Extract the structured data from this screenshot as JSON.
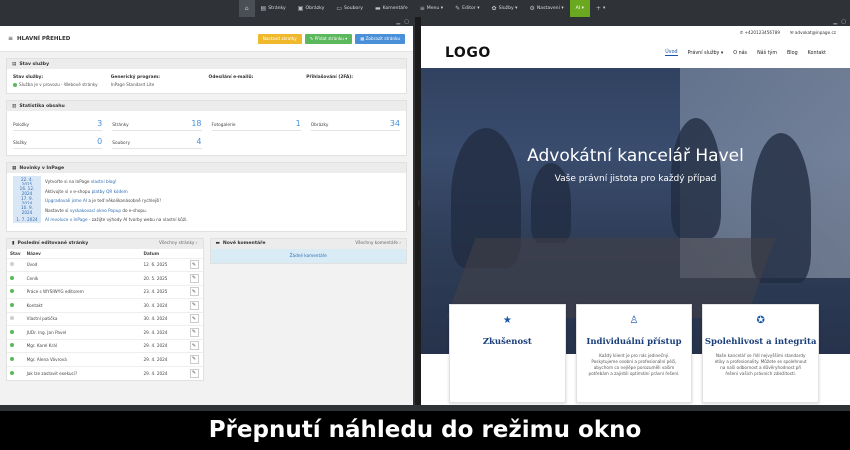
{
  "topbar": {
    "items": [
      {
        "icon": "home-icon",
        "glyph": "⌂",
        "label": ""
      },
      {
        "icon": "pages-icon",
        "glyph": "▤",
        "label": "Stránky"
      },
      {
        "icon": "image-icon",
        "glyph": "▣",
        "label": "Obrázky"
      },
      {
        "icon": "folder-icon",
        "glyph": "▭",
        "label": "Soubory"
      },
      {
        "icon": "comment-icon",
        "glyph": "▬",
        "label": "Komentáře"
      },
      {
        "icon": "menu-icon",
        "glyph": "≡",
        "label": "Menu ▾"
      },
      {
        "icon": "pencil-icon",
        "glyph": "✎",
        "label": "Editor ▾"
      },
      {
        "icon": "services-icon",
        "glyph": "✿",
        "label": "Služby ▾"
      },
      {
        "icon": "gear-icon",
        "glyph": "⚙",
        "label": "Nastavení ▾"
      },
      {
        "icon": "",
        "glyph": "",
        "label": "AI ▾"
      },
      {
        "icon": "plus-icon",
        "glyph": "+",
        "label": "▾"
      }
    ]
  },
  "admin": {
    "title": "HLAVNÍ PŘEHLED",
    "buttons": {
      "settings": "Nastavit zkratky",
      "post": "✎ Přidat stránku ▾",
      "notify": "▦ Zobrazit stránku"
    },
    "status": {
      "heading": "Stav služby",
      "cols": [
        {
          "label": "Stav služby:",
          "value": "Služba je v provozu - Webové stránky",
          "dot": true
        },
        {
          "label": "Generický program:",
          "value": "InPage Standard Lite",
          "dot": false
        },
        {
          "label": "Odesílání e-mailů:",
          "value": "",
          "dot": false
        },
        {
          "label": "Přihlašování (2FA):",
          "value": "",
          "dot": false
        }
      ]
    },
    "stats": {
      "heading": "Statistika obsahu",
      "items": [
        {
          "k": "Položky",
          "v": "3"
        },
        {
          "k": "Stránky",
          "v": "18"
        },
        {
          "k": "Fotogalerie",
          "v": "1"
        },
        {
          "k": "Obrázky",
          "v": "34"
        },
        {
          "k": "Složky",
          "v": "0"
        },
        {
          "k": "Soubory",
          "v": "4"
        }
      ]
    },
    "news": {
      "heading": "Novinky v InPage",
      "rows": [
        {
          "date": "22. 4. 2025",
          "pre": "Vytvořte si na InPage",
          "link": "vlastní blog!",
          "post": ""
        },
        {
          "date": "16. 12. 2024",
          "pre": "Aktivujte si v e-shopu",
          "link": "platby QR kódem",
          "post": ""
        },
        {
          "date": "17. 9. 2024",
          "pre": "",
          "link": "Upgradovali jsme AI",
          "post": "a je teď několikanásobně rychlejší!"
        },
        {
          "date": "10. 9. 2024",
          "pre": "Nastavte si",
          "link": "vyskakovací okno Popup",
          "post": "do e-shopu."
        },
        {
          "date": "1. 7. 2024",
          "pre": "",
          "link": "AI revoluce v InPage",
          "post": "- zažijte výhody AI tvorby webu na vlastní kůži."
        }
      ]
    },
    "recent": {
      "heading": "Poslední editované stránky",
      "more": "Všechny stránky ›",
      "cols": [
        "Stav",
        "Název",
        "Datum",
        ""
      ],
      "rows": [
        {
          "status": "draft",
          "name": "Úvod",
          "date": "12. 6. 2025"
        },
        {
          "status": "ok",
          "name": "Ceník",
          "date": "20. 5. 2025"
        },
        {
          "status": "ok",
          "name": "Práce s WYSIWYG editorem",
          "date": "23. 4. 2025"
        },
        {
          "status": "ok",
          "name": "Kontakt",
          "date": "30. 4. 2024"
        },
        {
          "status": "draft",
          "name": "Vlastní patička",
          "date": "30. 4. 2024"
        },
        {
          "status": "ok",
          "name": "JUDr. Ing. Jan Pavel",
          "date": "29. 4. 2024"
        },
        {
          "status": "ok",
          "name": "Mgr. Karel Král",
          "date": "29. 4. 2024"
        },
        {
          "status": "ok",
          "name": "Mgr. Alena Vávrová",
          "date": "29. 4. 2024"
        },
        {
          "status": "ok",
          "name": "Jak lze zastavit exekuci?",
          "date": "29. 4. 2024"
        }
      ]
    },
    "comments": {
      "heading": "Nové komentáře",
      "more": "Všechny komentáře ›",
      "empty": "Žádné komentáře"
    }
  },
  "site": {
    "phone": "✆ +420123456789",
    "email": "✉ advokat@inpage.cz",
    "logo": "LOGO",
    "nav": [
      "Úvod",
      "Právní služby ▾",
      "O nás",
      "Náš tým",
      "Blog",
      "Kontakt"
    ],
    "hero_title": "Advokátní kancelář Havel",
    "hero_sub": "Vaše právní jistota pro každý případ",
    "cards": [
      {
        "icon": "star-icon",
        "glyph": "★",
        "title": "Zkušenost",
        "desc": ""
      },
      {
        "icon": "user-icon",
        "glyph": "♙",
        "title": "Individuální přístup",
        "desc": "Každý klient je pro nás jedinečný. Poskytujeme osobní a profesionální péči, abychom co nejlépe porozuměli vašim potřebám a zajistili optimální právní řešení."
      },
      {
        "icon": "award-icon",
        "glyph": "✪",
        "title": "Spolehlivost a integrita",
        "desc": "Naše kancelář se řídí nejvyššími standardy etiky a profesionality. Můžete se spolehnout na naši odbornost a důvěryhodnost při řešení vašich právních záležitostí."
      }
    ]
  },
  "caption": "Přepnutí náhledu do režimu okno",
  "colors": {
    "accent": "#1a56a8",
    "topbar": "#2f3237",
    "ai": "#6aa820"
  }
}
